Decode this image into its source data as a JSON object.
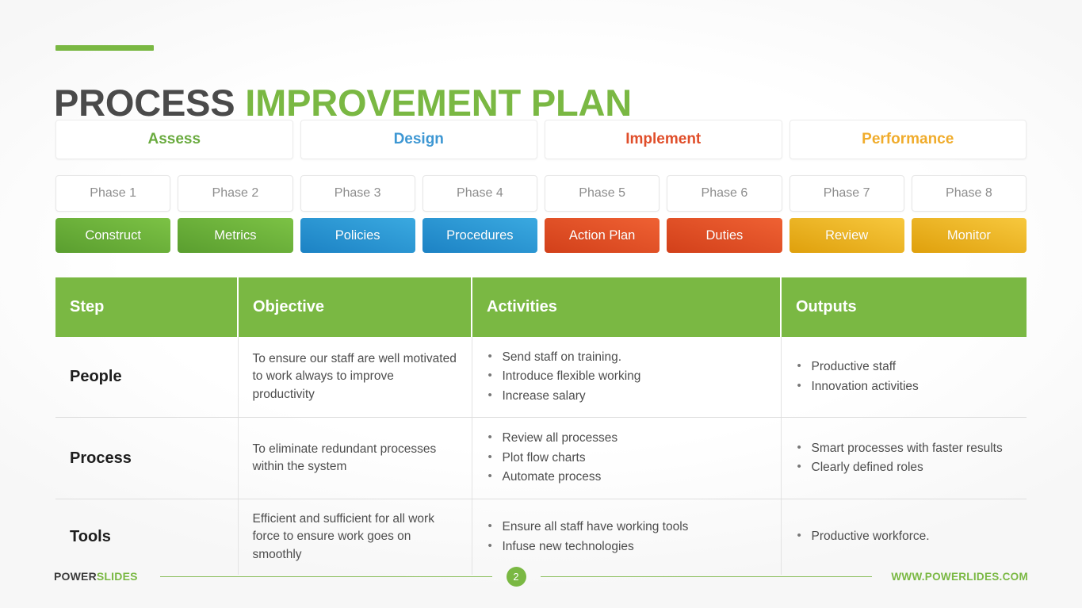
{
  "slide": {
    "title_part1": "PROCESS",
    "title_part2": "IMPROVEMENT PLAN",
    "accent_color": "#7ab843"
  },
  "categories": [
    {
      "label": "Assess",
      "color": "#6aab3f"
    },
    {
      "label": "Design",
      "color": "#3d97d3"
    },
    {
      "label": "Implement",
      "color": "#e04e2a"
    },
    {
      "label": "Performance",
      "color": "#f0ac2c"
    }
  ],
  "phases": [
    {
      "phase": "Phase 1",
      "label": "Construct",
      "style": "green"
    },
    {
      "phase": "Phase 2",
      "label": "Metrics",
      "style": "green"
    },
    {
      "phase": "Phase 3",
      "label": "Policies",
      "style": "blue"
    },
    {
      "phase": "Phase 4",
      "label": "Procedures",
      "style": "blue"
    },
    {
      "phase": "Phase 5",
      "label": "Action Plan",
      "style": "red"
    },
    {
      "phase": "Phase 6",
      "label": "Duties",
      "style": "red"
    },
    {
      "phase": "Phase 7",
      "label": "Review",
      "style": "amber"
    },
    {
      "phase": "Phase 8",
      "label": "Monitor",
      "style": "amber"
    }
  ],
  "table": {
    "header_color": "#7ab843",
    "columns": [
      "Step",
      "Objective",
      "Activities",
      "Outputs"
    ],
    "rows": [
      {
        "step": "People",
        "objective": "To ensure our staff are well motivated to work always to improve productivity",
        "activities": [
          "Send staff on training.",
          "Introduce flexible working",
          "Increase salary"
        ],
        "outputs": [
          "Productive staff",
          "Innovation activities"
        ]
      },
      {
        "step": "Process",
        "objective": "To eliminate redundant processes within the system",
        "activities": [
          "Review all processes",
          "Plot flow charts",
          "Automate process"
        ],
        "outputs": [
          "Smart processes with faster results",
          "Clearly defined roles"
        ]
      },
      {
        "step": "Tools",
        "objective": "Efficient and sufficient for all work force to ensure work goes on smoothly",
        "activities": [
          "Ensure all staff have working tools",
          "Infuse new technologies"
        ],
        "outputs": [
          "Productive workforce."
        ]
      }
    ]
  },
  "footer": {
    "brand_part1": "POWER",
    "brand_part2": "SLIDES",
    "page_number": "2",
    "website": "WWW.POWERLIDES.COM"
  }
}
